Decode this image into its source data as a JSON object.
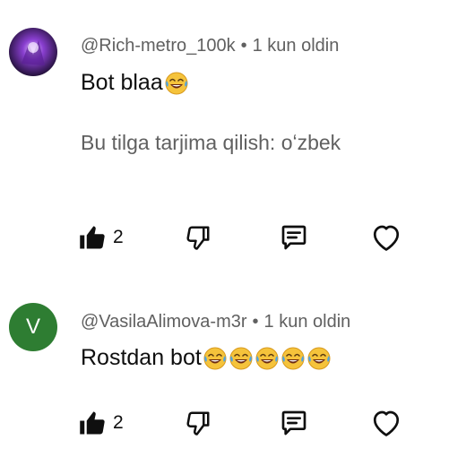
{
  "comments": [
    {
      "handle": "@Rich-metro_100k",
      "separator": "•",
      "time": "1 kun oldin",
      "text": "Bot blaa",
      "emojis": [
        "joy-emoji"
      ],
      "translate_text": "Bu tilga tarjima qilish: oʻzbek",
      "like_count": "2",
      "avatar_colors": [
        "#1a0d2e",
        "#7b2fbf",
        "#d9b3ff"
      ]
    },
    {
      "handle": "@VasilaAlimova-m3r",
      "separator": "•",
      "time": "1 kun oldin",
      "text": "Rostdan bot",
      "emojis": [
        "joy-emoji",
        "joy-emoji",
        "joy-emoji",
        "joy-emoji",
        "joy-emoji"
      ],
      "avatar_letter": "V",
      "avatar_color": "#2e7d32",
      "like_count": "2"
    }
  ],
  "icons": {
    "like": "thumbs-up-icon",
    "dislike": "thumbs-down-icon",
    "reply": "reply-icon",
    "heart": "heart-icon"
  },
  "colors": {
    "text_primary": "#0f0f0f",
    "text_secondary": "#606060",
    "emoji_face": "#f5c33b"
  }
}
